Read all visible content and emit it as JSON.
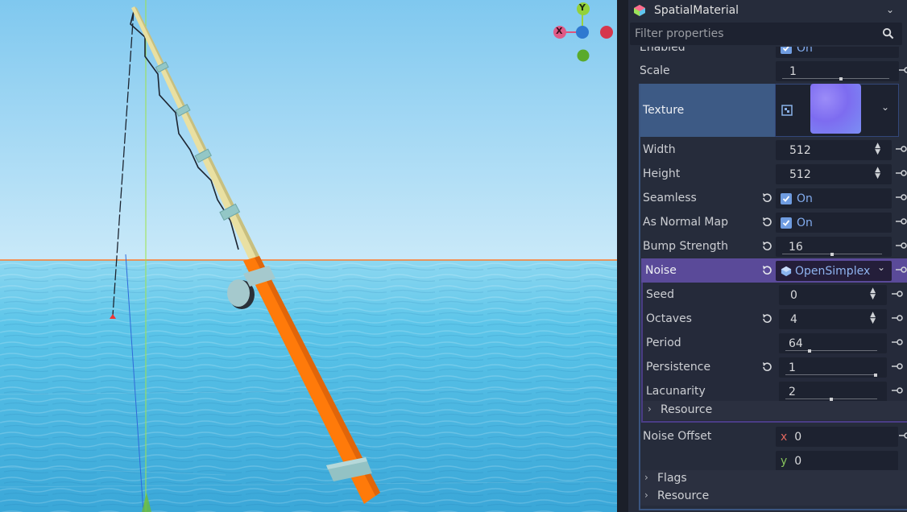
{
  "inspector": {
    "title": "SpatialMaterial",
    "filter_placeholder": "Filter properties"
  },
  "props": {
    "enabled": {
      "label": "Enabled",
      "value": "On"
    },
    "scale": {
      "label": "Scale",
      "value": "1",
      "slider_level": 0.55
    },
    "texture": {
      "label": "Texture"
    },
    "width": {
      "label": "Width",
      "value": "512"
    },
    "height": {
      "label": "Height",
      "value": "512"
    },
    "seamless": {
      "label": "Seamless",
      "value": "On"
    },
    "normal_map": {
      "label": "As Normal Map",
      "value": "On"
    },
    "bump": {
      "label": "Bump Strength",
      "value": "16",
      "slider_level": 0.5
    },
    "noise": {
      "label": "Noise",
      "value": "OpenSimplex"
    },
    "seed": {
      "label": "Seed",
      "value": "0"
    },
    "octaves": {
      "label": "Octaves",
      "value": "4"
    },
    "period": {
      "label": "Period",
      "value": "64",
      "slider_level": 0.25
    },
    "persistence": {
      "label": "Persistence",
      "value": "1",
      "slider_level": 1.0
    },
    "lacunarity": {
      "label": "Lacunarity",
      "value": "2",
      "slider_level": 0.5
    },
    "noise_resource": {
      "label": "Resource"
    },
    "noise_offset": {
      "label": "Noise Offset",
      "x_label": "x",
      "x": "0",
      "y_label": "y",
      "y": "0"
    },
    "flags": {
      "label": "Flags"
    },
    "resource": {
      "label": "Resource"
    }
  },
  "gizmo": {
    "y": "Y",
    "x": "X"
  },
  "colors": {
    "accent": "#6f9ce0",
    "selected_row": "#3a5580",
    "noise_row": "#5a4a99",
    "rod_orange": "#ff7a0a",
    "rod_cream": "#e9e0a2",
    "sky": "#a9daf4",
    "sea": "#56c2e6"
  }
}
